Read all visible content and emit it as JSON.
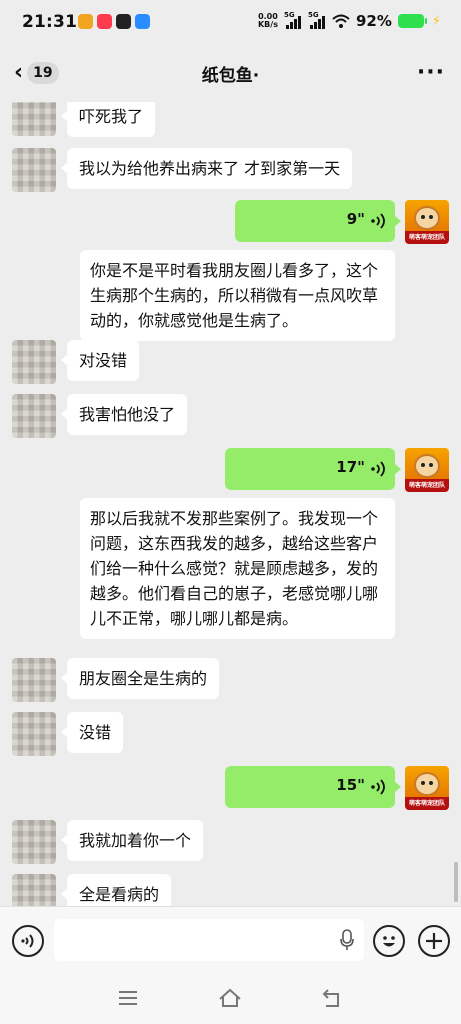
{
  "status_bar": {
    "time": "21:31",
    "net_speed_value": "0.00",
    "net_speed_unit": "KB/s",
    "signal_1_label": "5G",
    "signal_2_label": "5G",
    "battery_percent": "92%",
    "app_icons": [
      "#f2a51f",
      "#ff3b4e",
      "#222222",
      "#2b8cff"
    ],
    "battery_color": "#2ee04d"
  },
  "header": {
    "back_count": "19",
    "title": "纸包鱼·",
    "more_icon": "more-dots-icon"
  },
  "messages": [
    {
      "side": "in",
      "text": "吓死我了"
    },
    {
      "side": "in",
      "text": "我以为给他养出病来了 才到家第一天"
    },
    {
      "side": "out",
      "type": "voice",
      "duration": "9\"",
      "transcript": "你是不是平时看我朋友圈儿看多了，这个生病那个生病的，所以稍微有一点风吹草动的，你就感觉他是生病了。"
    },
    {
      "side": "in",
      "text": "对没错"
    },
    {
      "side": "in",
      "text": "我害怕他没了"
    },
    {
      "side": "out",
      "type": "voice",
      "duration": "17\"",
      "transcript": "那以后我就不发那些案例了。我发现一个问题，这东西我发的越多，越给这些客户们给一种什么感觉？就是顾虑越多，发的越多。他们看自己的崽子，老感觉哪儿哪儿不正常，哪儿哪儿都是病。"
    },
    {
      "side": "in",
      "text": "朋友圈全是生病的"
    },
    {
      "side": "in",
      "text": "没错"
    },
    {
      "side": "out",
      "type": "voice",
      "duration": "15\""
    },
    {
      "side": "in",
      "text": "我就加着你一个"
    },
    {
      "side": "in",
      "text": "全是看病的"
    }
  ],
  "self_avatar_label": "萌客萌宠团队",
  "colors": {
    "background": "#ededed",
    "voice_bubble": "#95ec69",
    "incoming_bubble": "#ffffff"
  }
}
